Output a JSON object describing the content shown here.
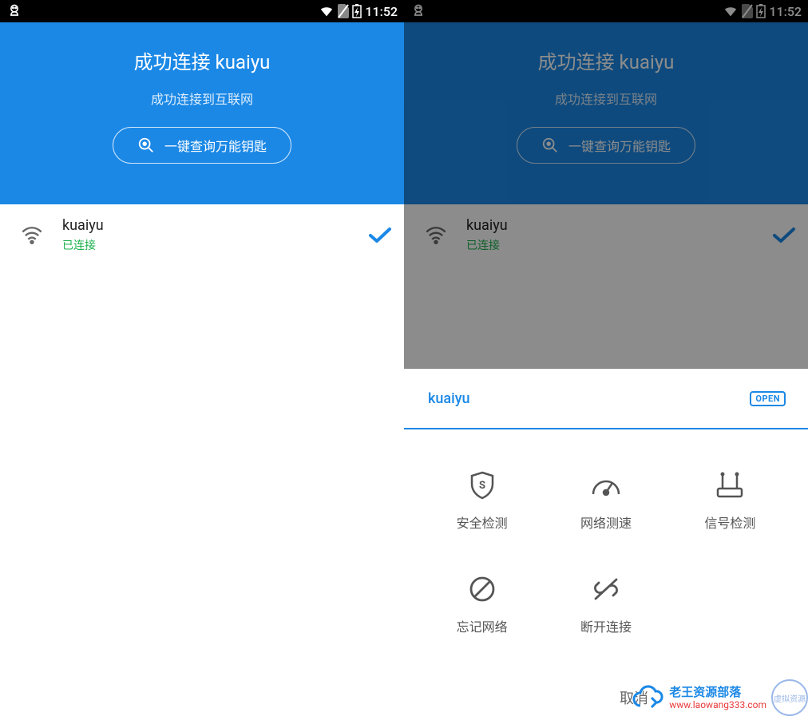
{
  "statusbar": {
    "time": "11:52"
  },
  "header": {
    "title": "成功连接 kuaiyu",
    "subtitle": "成功连接到互联网",
    "button_label": "一键查询万能钥匙"
  },
  "wifi": {
    "name": "kuaiyu",
    "status": "已连接"
  },
  "sheet": {
    "title": "kuaiyu",
    "open_badge": "OPEN",
    "actions": [
      {
        "icon": "shield-icon",
        "label": "安全检测"
      },
      {
        "icon": "gauge-icon",
        "label": "网络测速"
      },
      {
        "icon": "router-icon",
        "label": "信号检测"
      },
      {
        "icon": "forbid-icon",
        "label": "忘记网络"
      },
      {
        "icon": "unlink-icon",
        "label": "断开连接"
      }
    ],
    "cancel": "取消"
  },
  "watermark": {
    "name_cn": "老王资源部落",
    "url": "www.laowang333.com",
    "stamp": "虚拟资源"
  }
}
